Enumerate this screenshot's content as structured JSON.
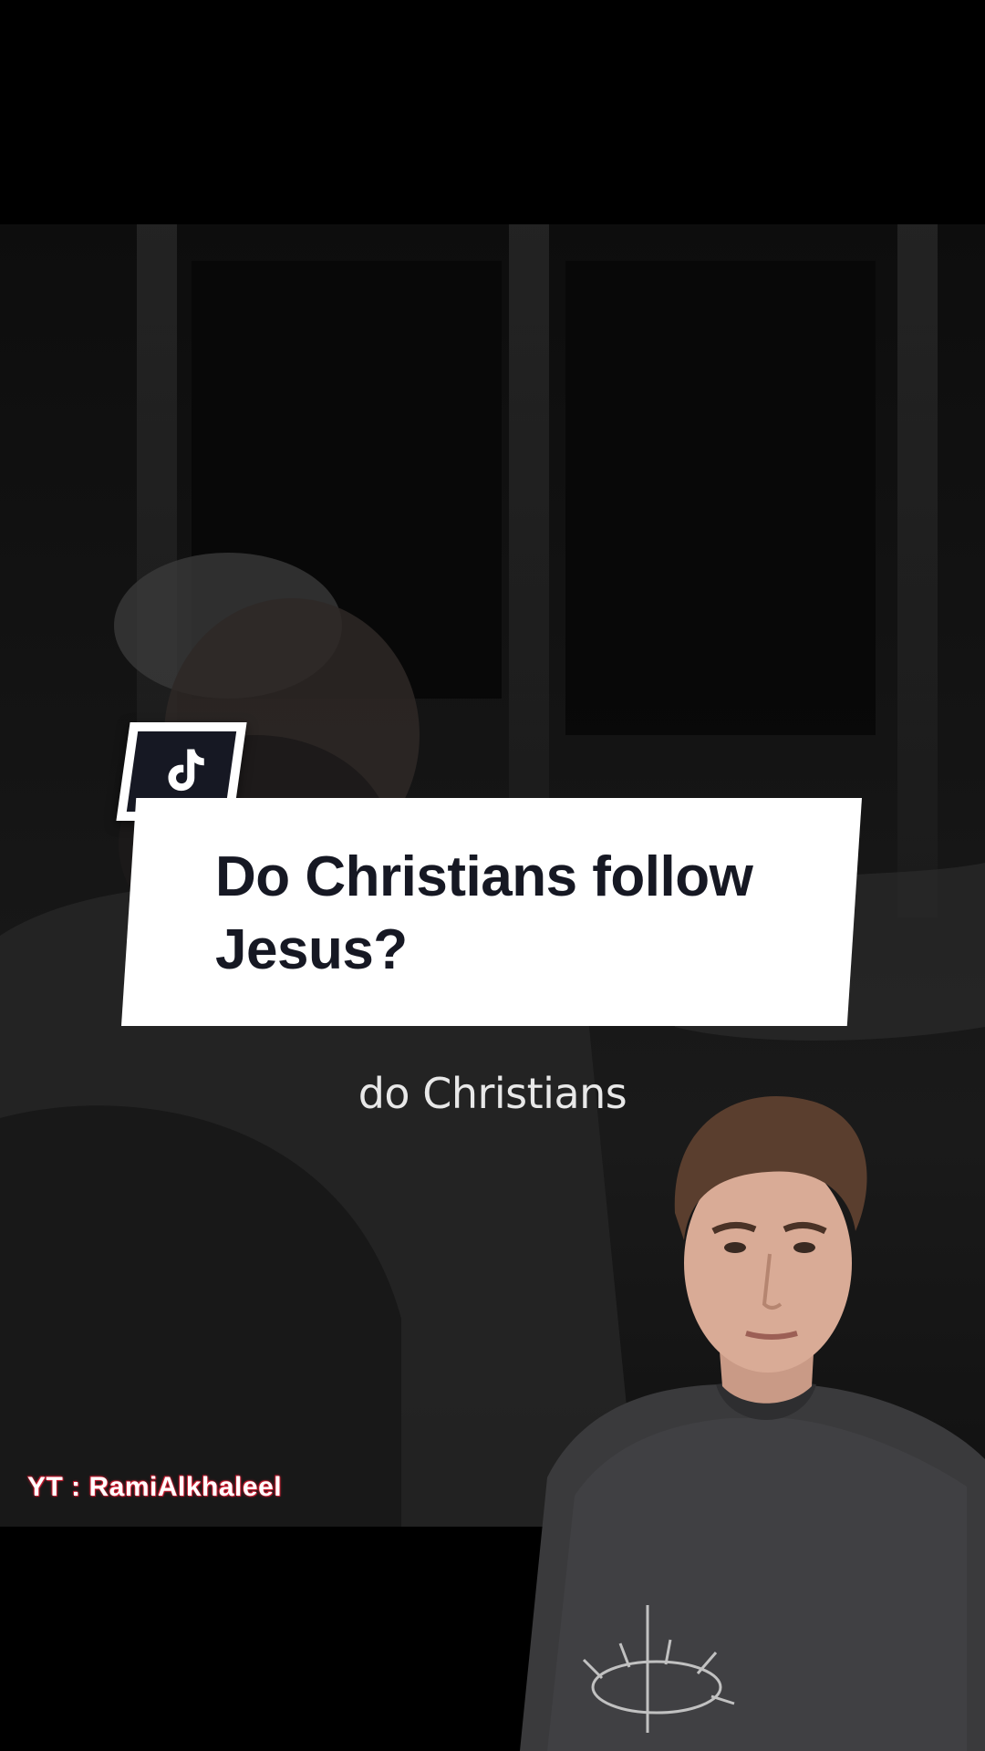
{
  "overlay": {
    "platform_icon": "tiktok-icon",
    "question_line1": "Do Christians follow",
    "question_line2": "Jesus?"
  },
  "video": {
    "subtitle": "do Christians",
    "credit": "YT : RamiAlkhaleel"
  },
  "colors": {
    "card_background": "#ffffff",
    "card_text": "#161823",
    "sticker_dark": "#161823",
    "credit_glow": "#e0243a",
    "page_background": "#000000"
  }
}
